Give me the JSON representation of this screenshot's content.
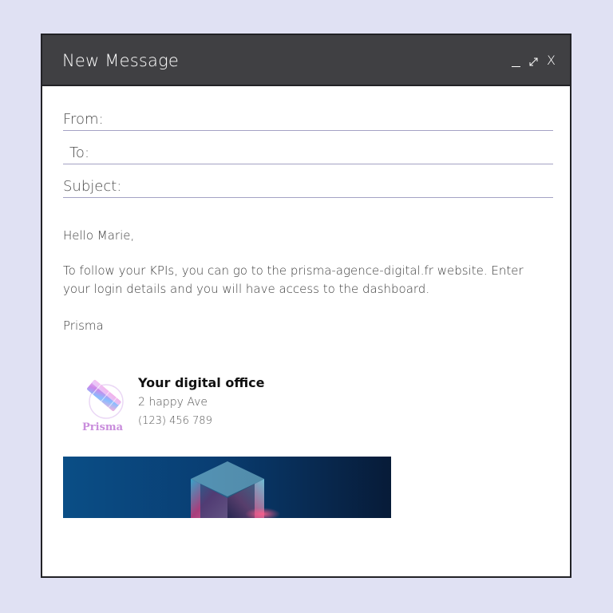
{
  "window": {
    "title": "New Message",
    "controls": [
      "minimize-icon",
      "expand-icon",
      "close-icon"
    ],
    "close_label": "X"
  },
  "fields": {
    "from_label": "From:",
    "to_label": "To:",
    "subject_label": "Subject:",
    "from_value": "",
    "to_value": "",
    "subject_value": ""
  },
  "message": {
    "greeting": "Hello Marie,",
    "paragraph": "To follow your KPIs, you can go to the prisma-agence-digital.fr website. Enter your login details and you will have access to the dashboard.",
    "signoff": "Prisma"
  },
  "signature": {
    "brand": "Prisma",
    "title": "Your digital office",
    "address": "2 happy Ave",
    "phone": "(123) 456 789"
  },
  "colors": {
    "background": "#e0e1f3",
    "titlebar": "#404043",
    "field_underline": "#a4a2c4",
    "brand": "#c98ddc",
    "banner": "#0a3a6e"
  }
}
